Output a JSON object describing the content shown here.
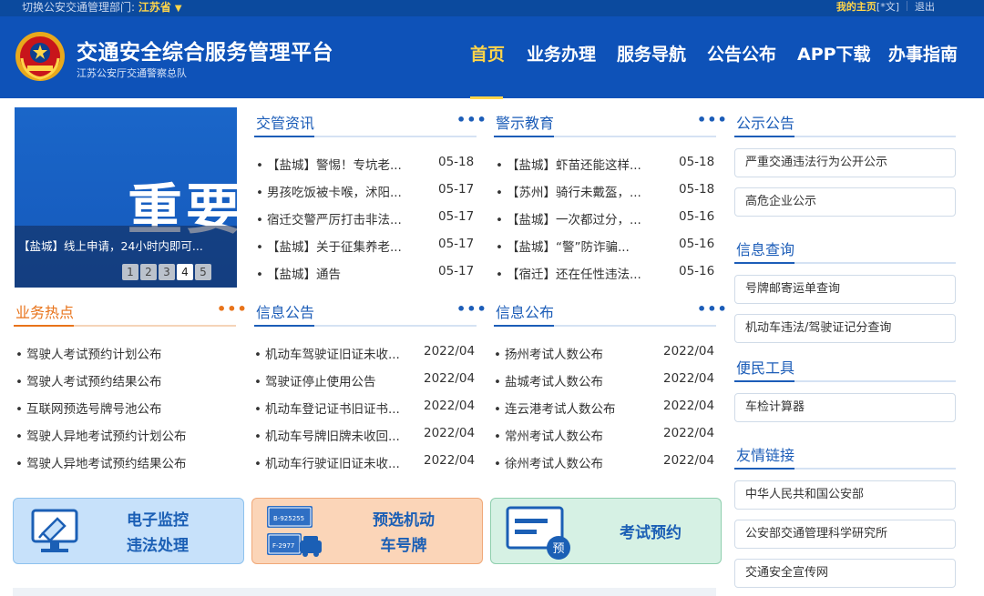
{
  "topbar": {
    "switch_label": "切换公安交通管理部门:",
    "province": "江苏省",
    "my_home": "我的主页",
    "lang": "[*文]",
    "logout": "退出"
  },
  "header": {
    "title": "交通安全综合服务管理平台",
    "subtitle": "江苏公安厅交通警察总队",
    "nav": [
      "首页",
      "业务办理",
      "服务导航",
      "公告公布",
      "APP下载",
      "办事指南"
    ],
    "active_index": 0
  },
  "banner": {
    "big_text": "重要",
    "caption": "【盐城】线上申请，24小时内即可...",
    "pages": [
      "1",
      "2",
      "3",
      "4",
      "5"
    ],
    "active_page": 4
  },
  "traffic_news": {
    "title": "交管资讯",
    "more": "•••",
    "items": [
      {
        "text": "【盐城】警惕！专坑老...",
        "date": "05-18"
      },
      {
        "text": "男孩吃饭被卡喉，沭阳...",
        "date": "05-17"
      },
      {
        "text": "宿迁交警严厉打击非法...",
        "date": "05-17"
      },
      {
        "text": "【盐城】关于征集养老...",
        "date": "05-17"
      },
      {
        "text": "【盐城】通告",
        "date": "05-17"
      }
    ]
  },
  "warning_edu": {
    "title": "警示教育",
    "more": "•••",
    "items": [
      {
        "text": "【盐城】虾苗还能这样...",
        "date": "05-18"
      },
      {
        "text": "【苏州】骑行未戴盔，...",
        "date": "05-18"
      },
      {
        "text": "【盐城】一次都过分，...",
        "date": "05-16"
      },
      {
        "text": "【盐城】“警”防诈骗...",
        "date": "05-16"
      },
      {
        "text": "【宿迁】还在任性违法...",
        "date": "05-16"
      }
    ]
  },
  "hot_business": {
    "title": "业务热点",
    "more": "•••",
    "items": [
      "驾驶人考试预约计划公布",
      "驾驶人考试预约结果公布",
      "互联网预选号牌号池公布",
      "驾驶人异地考试预约计划公布",
      "驾驶人异地考试预约结果公布"
    ]
  },
  "info_notice": {
    "title": "信息公告",
    "more": "•••",
    "items": [
      {
        "text": "机动车驾驶证旧证未收...",
        "date": "2022/04"
      },
      {
        "text": "驾驶证停止使用公告",
        "date": "2022/04"
      },
      {
        "text": "机动车登记证书旧证书...",
        "date": "2022/04"
      },
      {
        "text": "机动车号牌旧牌未收回...",
        "date": "2022/04"
      },
      {
        "text": "机动车行驶证旧证未收...",
        "date": "2022/04"
      }
    ]
  },
  "info_publish": {
    "title": "信息公布",
    "more": "•••",
    "items": [
      {
        "text": "扬州考试人数公布",
        "date": "2022/04"
      },
      {
        "text": "盐城考试人数公布",
        "date": "2022/04"
      },
      {
        "text": "连云港考试人数公布",
        "date": "2022/04"
      },
      {
        "text": "常州考试人数公布",
        "date": "2022/04"
      },
      {
        "text": "徐州考试人数公布",
        "date": "2022/04"
      }
    ]
  },
  "right": {
    "public_notice": {
      "title": "公示公告",
      "items": [
        "严重交通违法行为公开公示",
        "高危企业公示"
      ]
    },
    "info_query": {
      "title": "信息查询",
      "items": [
        "号牌邮寄运单查询",
        "机动车违法/驾驶证记分查询"
      ]
    },
    "tools": {
      "title": "便民工具",
      "items": [
        "车检计算器"
      ]
    },
    "links": {
      "title": "友情链接",
      "items": [
        "中华人民共和国公安部",
        "公安部交通管理科学研究所",
        "交通安全宣传网"
      ]
    }
  },
  "cards": {
    "monitor": {
      "line1": "电子监控",
      "line2": "违法处理",
      "icon": "monitor-icon"
    },
    "plate": {
      "line1": "预选机动",
      "line2": "车号牌",
      "plate1": "B-925255",
      "plate2": "F-2977",
      "icon": "license-plate-icon"
    },
    "exam": {
      "label": "考试预约",
      "badge": "预",
      "icon": "exam-icon"
    }
  },
  "colors": {
    "header_bg": "#0e52b8",
    "topbar_bg": "#0b4a9e",
    "accent_yellow": "#ffd54a",
    "link_blue": "#1c5db8",
    "hot_orange": "#e8731a"
  }
}
